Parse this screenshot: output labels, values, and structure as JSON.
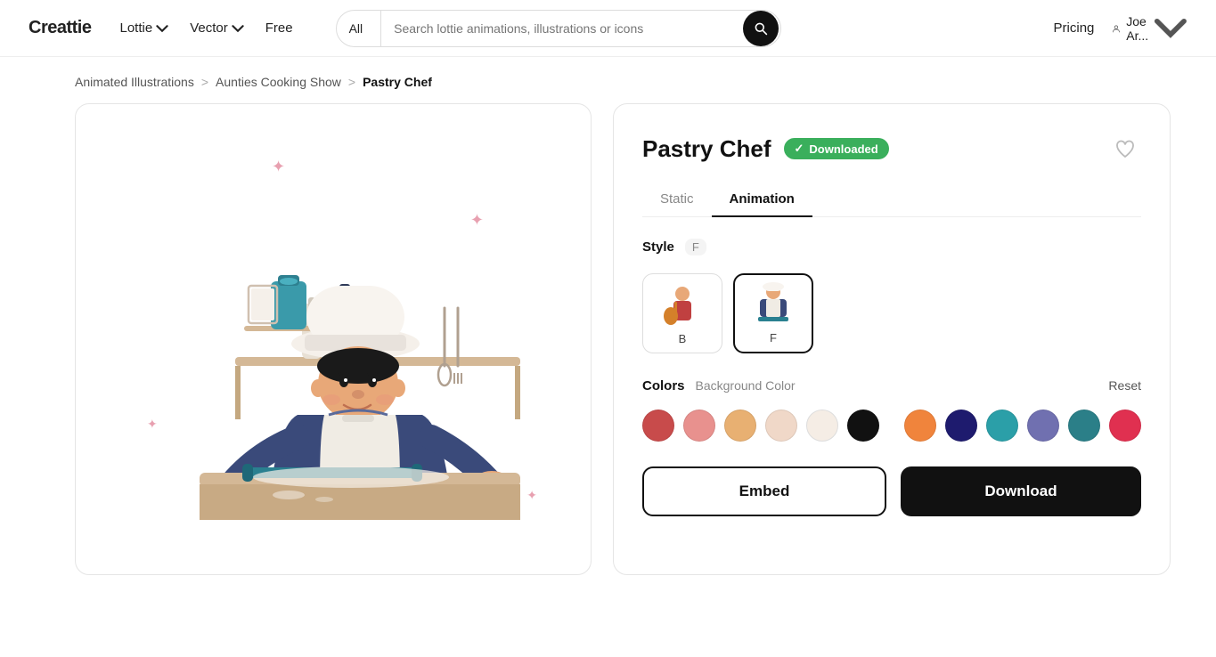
{
  "logo": {
    "text": "Creattie"
  },
  "navbar": {
    "lottie_label": "Lottie",
    "vector_label": "Vector",
    "free_label": "Free",
    "search_category": "All",
    "search_placeholder": "Search lottie animations, illustrations or icons",
    "pricing_label": "Pricing",
    "user_label": "Joe Ar..."
  },
  "breadcrumb": {
    "item1": "Animated Illustrations",
    "sep1": ">",
    "item2": "Aunties Cooking Show",
    "sep2": ">",
    "current": "Pastry Chef"
  },
  "detail": {
    "title": "Pastry Chef",
    "downloaded_label": "Downloaded",
    "tab_static": "Static",
    "tab_animation": "Animation",
    "style_label": "Style",
    "style_badge": "F",
    "card_b_label": "B",
    "card_f_label": "F",
    "colors_label": "Colors",
    "bg_color_label": "Background Color",
    "reset_label": "Reset",
    "swatches": [
      "#c84b4b",
      "#e8918e",
      "#e8b072",
      "#f0d8c8",
      "#f5ede5",
      "#111111",
      "#f0843c",
      "#1e1b6e",
      "#2b9fa8",
      "#7070b0",
      "#2b7f88",
      "#e03050"
    ],
    "embed_label": "Embed",
    "download_label": "Download"
  }
}
